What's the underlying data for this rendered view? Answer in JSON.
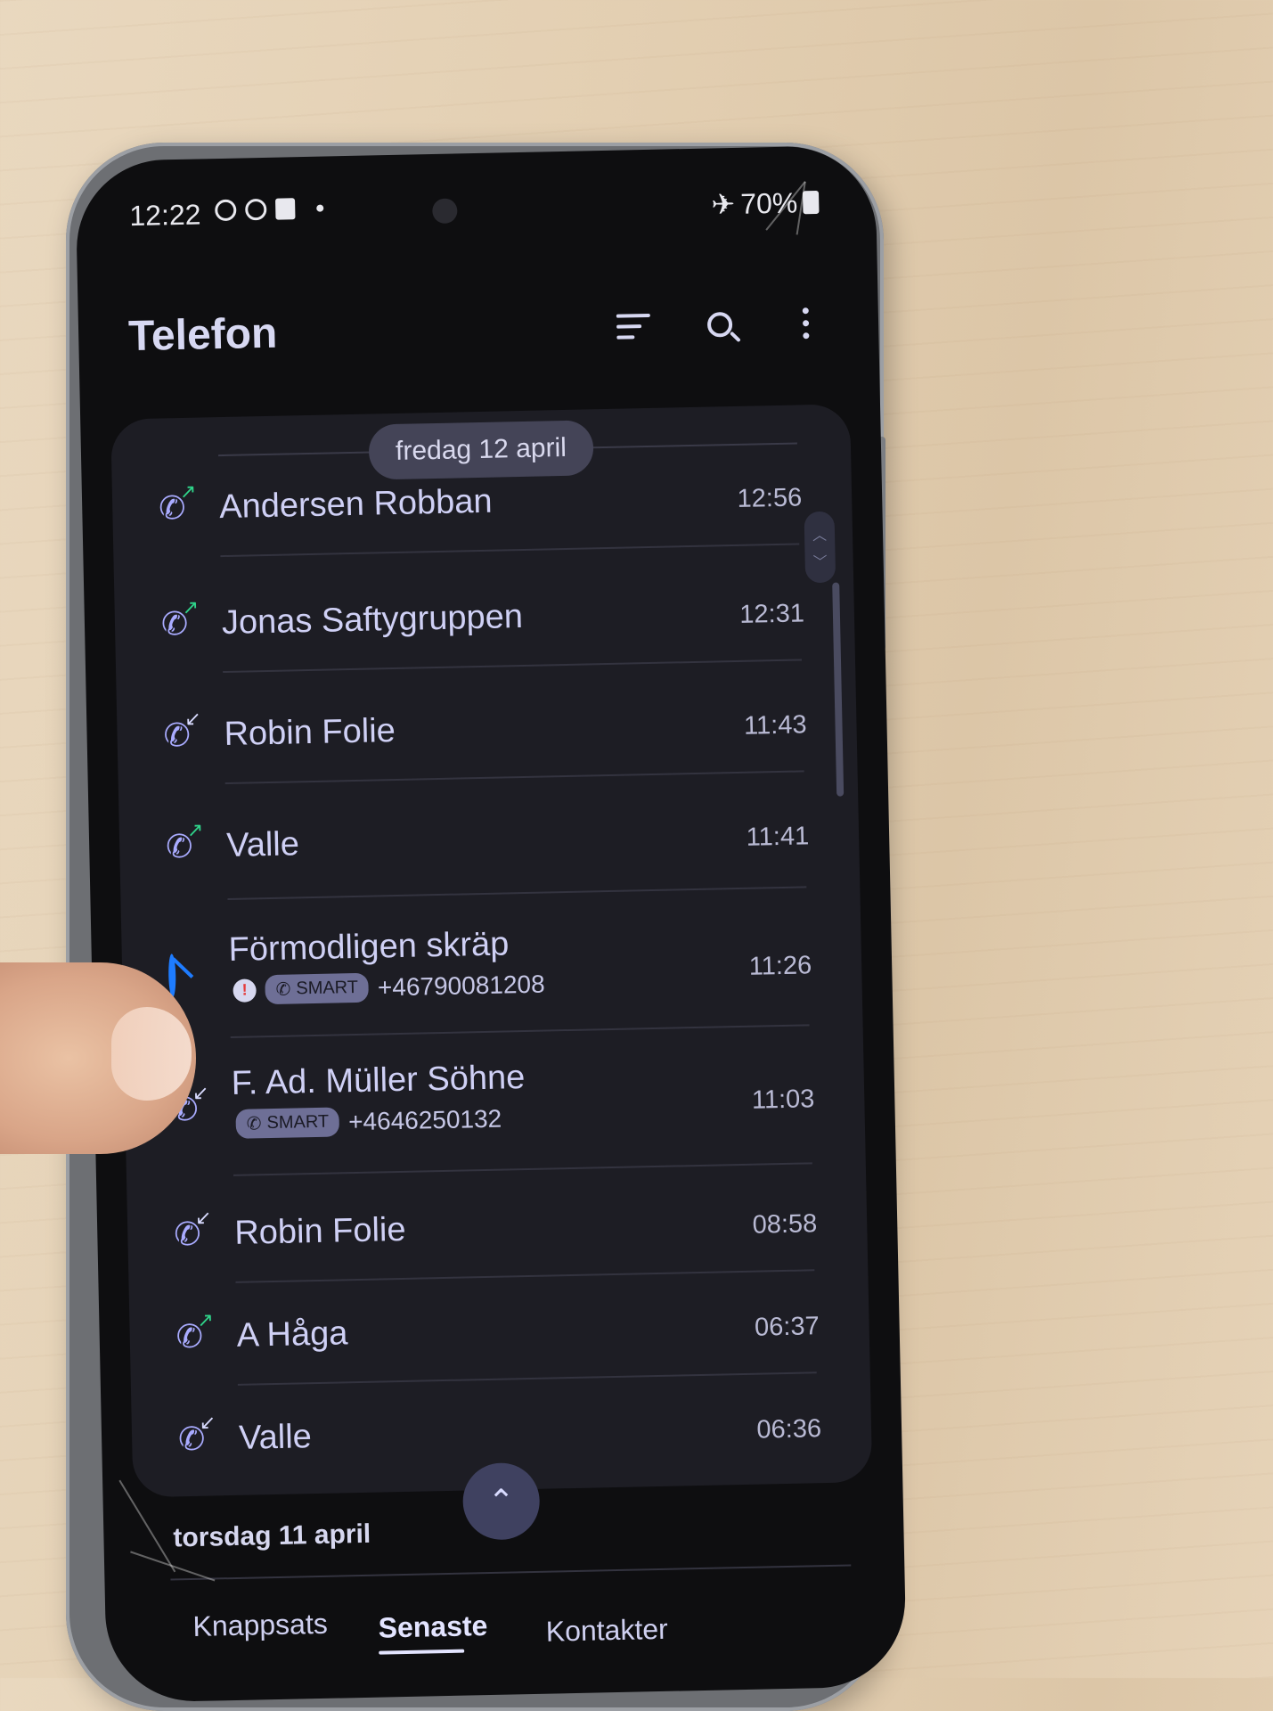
{
  "status_bar": {
    "time": "12:22",
    "battery": "70%",
    "airplane_icon": "airplane-icon"
  },
  "app": {
    "title": "Telefon",
    "actions": [
      "filter-icon",
      "search-icon",
      "more-options-icon"
    ]
  },
  "date_header": "fredag 12 april",
  "calls": [
    {
      "name": "Andersen Robban",
      "time": "12:56",
      "direction": "outgoing"
    },
    {
      "name": "Jonas Saftygruppen",
      "time": "12:31",
      "direction": "outgoing"
    },
    {
      "name": "Robin Folie",
      "time": "11:43",
      "direction": "incoming"
    },
    {
      "name": "Valle",
      "time": "11:41",
      "direction": "outgoing"
    },
    {
      "name": "Förmodligen skräp",
      "time": "11:26",
      "direction": "blocked",
      "badge": "SMART",
      "number": "+46790081208"
    },
    {
      "name": "F. Ad. Müller Söhne",
      "time": "11:03",
      "direction": "incoming",
      "badge": "SMART",
      "number": "+4646250132"
    },
    {
      "name": "Robin Folie",
      "time": "08:58",
      "direction": "incoming"
    },
    {
      "name": "A Håga",
      "time": "06:37",
      "direction": "outgoing"
    },
    {
      "name": "Valle",
      "time": "06:36",
      "direction": "incoming"
    }
  ],
  "next_section": "torsdag 11 april",
  "nav": {
    "keypad": "Knappsats",
    "recents": "Senaste",
    "contacts": "Kontakter"
  },
  "colors": {
    "accent": "#a9abff",
    "outgoing_arrow": "#2fd38a",
    "blocked": "#1e7cff",
    "card_bg": "#1d1d24"
  }
}
